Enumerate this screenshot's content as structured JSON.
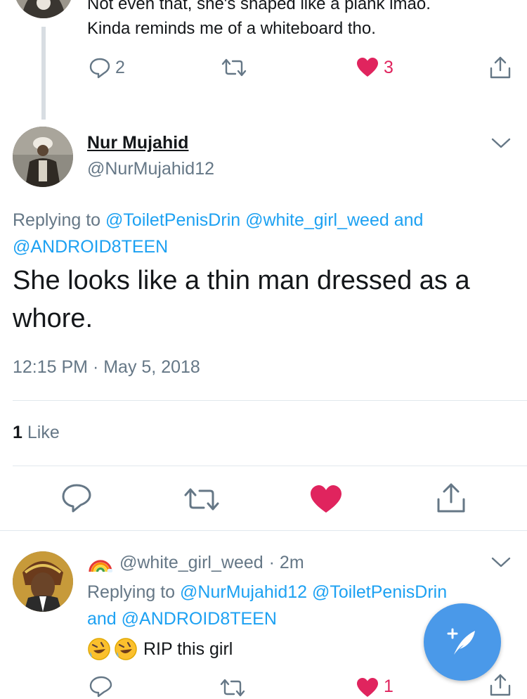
{
  "prev_tweet": {
    "text_line1": "Not even that, she's shaped like a plank lmao.",
    "text_line2": "Kinda reminds me of a whiteboard tho.",
    "reply_count": "2",
    "like_count": "3"
  },
  "main_tweet": {
    "display_name": "Nur Mujahid",
    "handle": "@NurMujahid12",
    "replying_prefix": "Replying to",
    "mention1": "@ToiletPenisDrin",
    "mention2": "@white_girl_weed",
    "and_word": "and",
    "mention3": "@ANDROID8TEEN",
    "text_line1": "She looks like a thin man dressed as a",
    "text_line2": "whore.",
    "timestamp": "12:15 PM · May 5, 2018",
    "like_num": "1",
    "like_label": "Like"
  },
  "reply_tweet": {
    "handle": "@white_girl_weed",
    "time": "· 2m",
    "replying_prefix": "Replying to",
    "mention1": "@NurMujahid12",
    "mention2": "@ToiletPenisDrin",
    "and_word": "and",
    "mention3": "@ANDROID8TEEN",
    "text": "RIP this girl",
    "like_count": "1"
  },
  "icons": {
    "reply": "reply-icon",
    "retweet": "retweet-icon",
    "like": "heart-icon",
    "share": "share-icon",
    "chevron": "chevron-down-icon",
    "compose": "compose-tweet-icon",
    "rainbow": "rainbow-emoji",
    "laugh": "rofl-emoji"
  },
  "colors": {
    "like": "#e0245e",
    "link": "#1da1f2",
    "muted": "#657786",
    "fab": "#4a99e9"
  }
}
